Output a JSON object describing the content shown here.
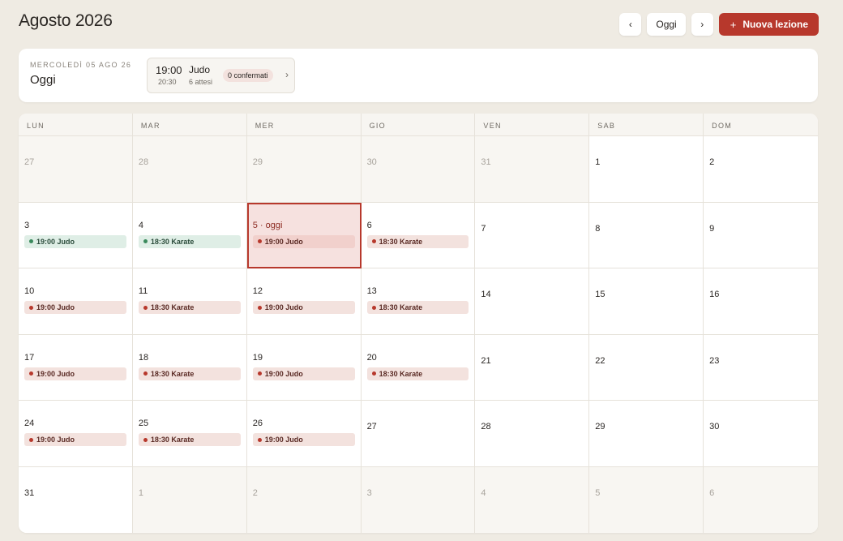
{
  "header": {
    "title": "Agosto 2026"
  },
  "toolbar": {
    "prev": "‹",
    "today": "Oggi",
    "next": "›",
    "new_lesson": "Nuova lezione",
    "plus": "+"
  },
  "today_card": {
    "date": "MERCOLEDÌ 05 AGO 26",
    "label": "Oggi",
    "lesson": {
      "start": "19:00",
      "end": "20:30",
      "name": "Judo",
      "expected": "6 attesi",
      "badge": "0 confermati",
      "chevron": "›"
    }
  },
  "calendar": {
    "weekdays": [
      "LUN",
      "MAR",
      "MER",
      "GIO",
      "VEN",
      "SAB",
      "DOM"
    ],
    "days": [
      {
        "label": "27",
        "other": true
      },
      {
        "label": "28",
        "other": true
      },
      {
        "label": "29",
        "other": true
      },
      {
        "label": "30",
        "other": true
      },
      {
        "label": "31",
        "other": true
      },
      {
        "label": "1"
      },
      {
        "label": "2"
      },
      {
        "label": "3",
        "event": {
          "text": "19:00 Judo",
          "green": true
        }
      },
      {
        "label": "4",
        "event": {
          "text": "18:30 Karate",
          "green": true
        }
      },
      {
        "label": "5 · oggi",
        "today": true,
        "event": {
          "text": "19:00 Judo"
        }
      },
      {
        "label": "6",
        "event": {
          "text": "18:30 Karate"
        }
      },
      {
        "label": "7"
      },
      {
        "label": "8"
      },
      {
        "label": "9"
      },
      {
        "label": "10",
        "event": {
          "text": "19:00 Judo"
        }
      },
      {
        "label": "11",
        "event": {
          "text": "18:30 Karate"
        }
      },
      {
        "label": "12",
        "event": {
          "text": "19:00 Judo"
        }
      },
      {
        "label": "13",
        "event": {
          "text": "18:30 Karate"
        }
      },
      {
        "label": "14"
      },
      {
        "label": "15"
      },
      {
        "label": "16"
      },
      {
        "label": "17",
        "event": {
          "text": "19:00 Judo"
        }
      },
      {
        "label": "18",
        "event": {
          "text": "18:30 Karate"
        }
      },
      {
        "label": "19",
        "event": {
          "text": "19:00 Judo"
        }
      },
      {
        "label": "20",
        "event": {
          "text": "18:30 Karate"
        }
      },
      {
        "label": "21"
      },
      {
        "label": "22"
      },
      {
        "label": "23"
      },
      {
        "label": "24",
        "event": {
          "text": "19:00 Judo"
        }
      },
      {
        "label": "25",
        "event": {
          "text": "18:30 Karate"
        }
      },
      {
        "label": "26",
        "event": {
          "text": "19:00 Judo"
        }
      },
      {
        "label": "27"
      },
      {
        "label": "28"
      },
      {
        "label": "29"
      },
      {
        "label": "30"
      },
      {
        "label": "31"
      },
      {
        "label": "1",
        "other": true
      },
      {
        "label": "2",
        "other": true
      },
      {
        "label": "3",
        "other": true
      },
      {
        "label": "4",
        "other": true
      },
      {
        "label": "5",
        "other": true
      },
      {
        "label": "6",
        "other": true
      }
    ]
  },
  "colors": {
    "accent": "#b7382c",
    "background": "#efebe3",
    "event_bg": "#f3e2de",
    "event_green_bg": "#dfeee6"
  }
}
